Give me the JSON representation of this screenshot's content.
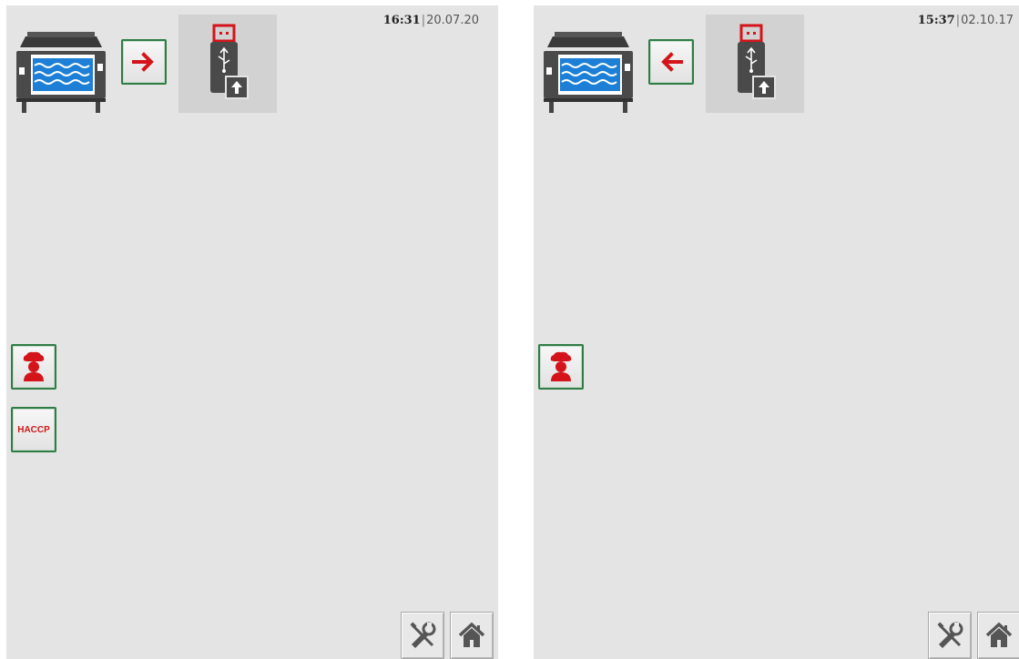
{
  "screens": [
    {
      "clock": {
        "time": "16:31",
        "separator": "|",
        "date": "20.07.20"
      },
      "transfer_direction": "right",
      "haccp_label": "HACCP"
    },
    {
      "clock": {
        "time": "15:37",
        "separator": "|",
        "date": "02.10.17"
      },
      "transfer_direction": "left"
    }
  ],
  "icons": {
    "device": "kettle-icon",
    "storage": "usb-stick-icon",
    "chef": "chef-icon",
    "tools": "tools-icon",
    "home": "home-icon"
  },
  "colors": {
    "accent_red": "#d4141a",
    "button_border": "#2f7d45",
    "panel_bg": "#e4e4e4"
  }
}
